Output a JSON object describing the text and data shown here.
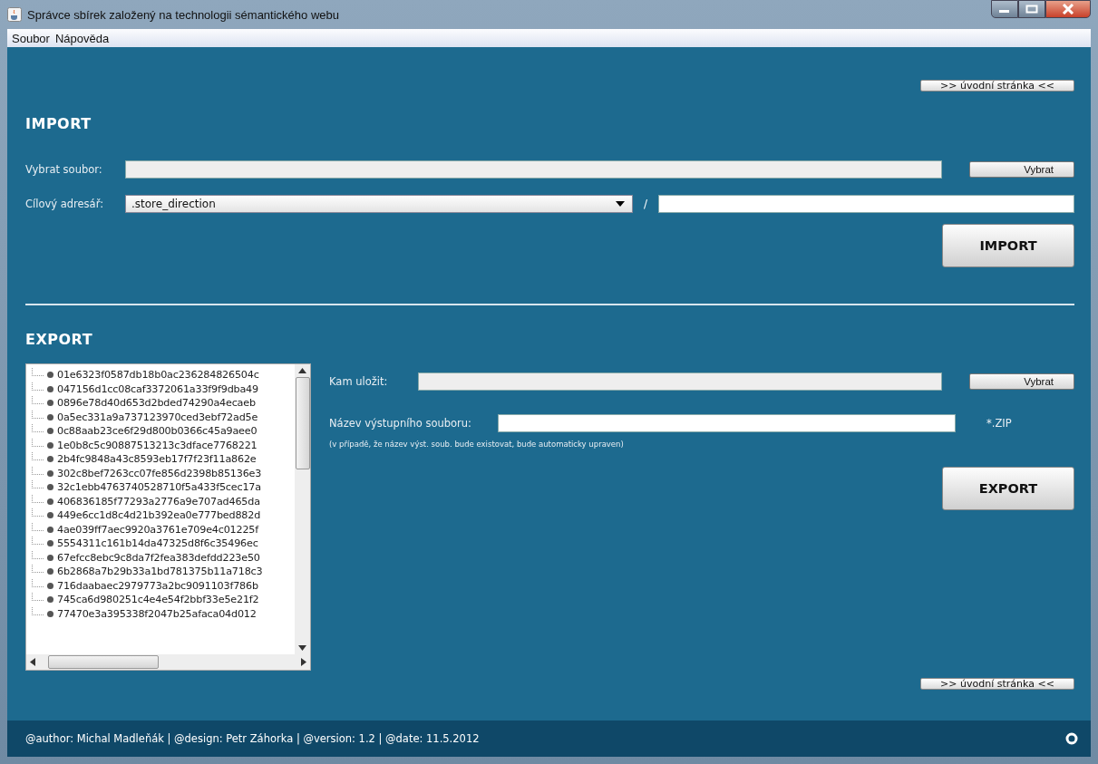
{
  "window": {
    "title": "Správce sbírek založený na technologii sémantického webu"
  },
  "menu": [
    "Soubor",
    "Nápověda"
  ],
  "home_link_top": ">> úvodní stránka <<",
  "import": {
    "heading": "IMPORT",
    "file_label": "Vybrat soubor:",
    "file_button": "Vybrat",
    "target_label": "Cílový adresář:",
    "target_value": ".store_direction",
    "separator": "/",
    "submit": "IMPORT"
  },
  "export": {
    "heading": "EXPORT",
    "items": [
      "01e6323f0587db18b0ac236284826504c",
      "047156d1cc08caf3372061a33f9f9dba49",
      "0896e78d40d653d2bded74290a4ecaeb",
      "0a5ec331a9a737123970ced3ebf72ad5e",
      "0c88aab23ce6f29d800b0366c45a9aee0",
      "1e0b8c5c90887513213c3dface7768221",
      "2b4fc9848a43c8593eb17f7f23f11a862e",
      "302c8bef7263cc07fe856d2398b85136e3",
      "32c1ebb4763740528710f5a433f5cec17a",
      "406836185f77293a2776a9e707ad465da",
      "449e6cc1d8c4d21b392ea0e777bed882d",
      "4ae039ff7aec9920a3761e709e4c01225f",
      "5554311c161b14da47325d8f6c35496ec",
      "67efcc8ebc9c8da7f2fea383defdd223e50",
      "6b2868a7b29b33a1bd781375b11a718c3",
      "716daabaec2979773a2bc9091103f786b",
      "745ca6d980251c4e4e54f2bbf33e5e21f2",
      "77470e3a395338f2047b25afaca04d012"
    ],
    "save_label": "Kam uložit:",
    "save_button": "Vybrat",
    "name_label": "Název výstupního souboru:",
    "name_suffix": "*.ZIP",
    "note": "(v případě, že název výst. soub. bude existovat, bude automaticky upraven)",
    "submit": "EXPORT"
  },
  "home_link_bottom": ">> úvodní stránka <<",
  "status_bar": "@author: Michal Madleňák | @design: Petr Záhorka | @version: 1.2 | @date: 11.5.2012"
}
